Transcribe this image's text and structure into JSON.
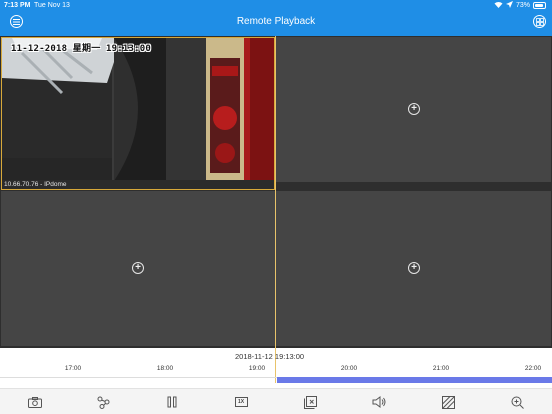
{
  "status_bar": {
    "time": "7:13 PM",
    "date": "Tue Nov 13",
    "battery": "73%",
    "battery_level": 0.73
  },
  "nav": {
    "title": "Remote Playback",
    "menu_icon": "menu-icon",
    "device_icon": "device-list-icon"
  },
  "panes": {
    "active": {
      "osd_datetime": "11-12-2018 星期一 19:13:00",
      "camera_label": "10.66.70.76 - IPdome"
    },
    "add_icon": "add-channel-icon"
  },
  "timeline": {
    "current_datetime": "2018-11-12  19:13:00",
    "ticks": [
      {
        "label": "17:00",
        "hour": 17
      },
      {
        "label": "18:00",
        "hour": 18
      },
      {
        "label": "19:00",
        "hour": 19
      },
      {
        "label": "20:00",
        "hour": 20
      },
      {
        "label": "21:00",
        "hour": 21
      },
      {
        "label": "22:00",
        "hour": 22
      }
    ],
    "recording_start_hour": 19.217,
    "cursor_hour": 19.217,
    "colors": {
      "recording": "#6a79e8",
      "cursor": "#e8c36a"
    }
  },
  "toolbar": {
    "speed_label": "1X",
    "icons": [
      "camera-snapshot-icon",
      "rotate-icon",
      "pause-icon",
      "speed-icon",
      "close-window-icon",
      "volume-icon",
      "image-quality-icon",
      "zoom-icon"
    ]
  },
  "colors": {
    "accent": "#1f8ee6",
    "selected_pane_border": "#d8a93a"
  }
}
